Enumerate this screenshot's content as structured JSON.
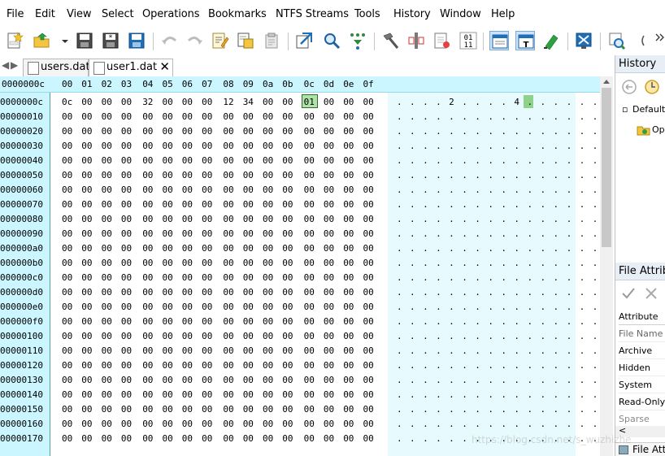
{
  "menu": {
    "items": [
      "File",
      "Edit",
      "View",
      "Select",
      "Operations",
      "Bookmarks",
      "NTFS Streams",
      "Tools",
      "History",
      "Window",
      "Help"
    ]
  },
  "toolbar": {
    "icons": [
      "new-file-icon",
      "open-file-icon",
      "dropdown-icon",
      "save-icon",
      "save-as-icon",
      "save-all-icon",
      "undo-icon",
      "redo-icon",
      "edit-icon",
      "copy-icon",
      "paste-icon",
      "goto-icon",
      "find-icon",
      "find-next-icon",
      "hammer-icon",
      "mark-icon",
      "compare-icon",
      "binary-icon",
      "view-hex-icon",
      "view-text-icon",
      "highlight-icon",
      "fullscreen-icon",
      "search-doc-icon",
      "overflow-icon"
    ]
  },
  "tabs": [
    {
      "label": "users.dat",
      "active": false
    },
    {
      "label": "user1.dat",
      "active": true,
      "close": "✕"
    }
  ],
  "hex": {
    "header_offset": "0000000c",
    "columns": [
      "00",
      "01",
      "02",
      "03",
      "04",
      "05",
      "06",
      "07",
      "08",
      "09",
      "0a",
      "0b",
      "0c",
      "0d",
      "0e",
      "0f"
    ],
    "rows": [
      {
        "offset": "0000000c",
        "bytes": [
          "0c",
          "00",
          "00",
          "00",
          "32",
          "00",
          "00",
          "00",
          "12",
          "34",
          "00",
          "00",
          "01",
          "00",
          "00",
          "00"
        ],
        "text": ". . . . 2 . . . . 4 . . . . . ."
      },
      {
        "offset": "00000010",
        "bytes": [
          "00",
          "00",
          "00",
          "00",
          "00",
          "00",
          "00",
          "00",
          "00",
          "00",
          "00",
          "00",
          "00",
          "00",
          "00",
          "00"
        ],
        "text": ". . . . . . . . . . . . . . . ."
      },
      {
        "offset": "00000020",
        "bytes": [
          "00",
          "00",
          "00",
          "00",
          "00",
          "00",
          "00",
          "00",
          "00",
          "00",
          "00",
          "00",
          "00",
          "00",
          "00",
          "00"
        ],
        "text": ". . . . . . . . . . . . . . . ."
      },
      {
        "offset": "00000030",
        "bytes": [
          "00",
          "00",
          "00",
          "00",
          "00",
          "00",
          "00",
          "00",
          "00",
          "00",
          "00",
          "00",
          "00",
          "00",
          "00",
          "00"
        ],
        "text": ". . . . . . . . . . . . . . . ."
      },
      {
        "offset": "00000040",
        "bytes": [
          "00",
          "00",
          "00",
          "00",
          "00",
          "00",
          "00",
          "00",
          "00",
          "00",
          "00",
          "00",
          "00",
          "00",
          "00",
          "00"
        ],
        "text": ". . . . . . . . . . . . . . . ."
      },
      {
        "offset": "00000050",
        "bytes": [
          "00",
          "00",
          "00",
          "00",
          "00",
          "00",
          "00",
          "00",
          "00",
          "00",
          "00",
          "00",
          "00",
          "00",
          "00",
          "00"
        ],
        "text": ". . . . . . . . . . . . . . . ."
      },
      {
        "offset": "00000060",
        "bytes": [
          "00",
          "00",
          "00",
          "00",
          "00",
          "00",
          "00",
          "00",
          "00",
          "00",
          "00",
          "00",
          "00",
          "00",
          "00",
          "00"
        ],
        "text": ". . . . . . . . . . . . . . . ."
      },
      {
        "offset": "00000070",
        "bytes": [
          "00",
          "00",
          "00",
          "00",
          "00",
          "00",
          "00",
          "00",
          "00",
          "00",
          "00",
          "00",
          "00",
          "00",
          "00",
          "00"
        ],
        "text": ". . . . . . . . . . . . . . . ."
      },
      {
        "offset": "00000080",
        "bytes": [
          "00",
          "00",
          "00",
          "00",
          "00",
          "00",
          "00",
          "00",
          "00",
          "00",
          "00",
          "00",
          "00",
          "00",
          "00",
          "00"
        ],
        "text": ". . . . . . . . . . . . . . . ."
      },
      {
        "offset": "00000090",
        "bytes": [
          "00",
          "00",
          "00",
          "00",
          "00",
          "00",
          "00",
          "00",
          "00",
          "00",
          "00",
          "00",
          "00",
          "00",
          "00",
          "00"
        ],
        "text": ". . . . . . . . . . . . . . . ."
      },
      {
        "offset": "000000a0",
        "bytes": [
          "00",
          "00",
          "00",
          "00",
          "00",
          "00",
          "00",
          "00",
          "00",
          "00",
          "00",
          "00",
          "00",
          "00",
          "00",
          "00"
        ],
        "text": ". . . . . . . . . . . . . . . ."
      },
      {
        "offset": "000000b0",
        "bytes": [
          "00",
          "00",
          "00",
          "00",
          "00",
          "00",
          "00",
          "00",
          "00",
          "00",
          "00",
          "00",
          "00",
          "00",
          "00",
          "00"
        ],
        "text": ". . . . . . . . . . . . . . . ."
      },
      {
        "offset": "000000c0",
        "bytes": [
          "00",
          "00",
          "00",
          "00",
          "00",
          "00",
          "00",
          "00",
          "00",
          "00",
          "00",
          "00",
          "00",
          "00",
          "00",
          "00"
        ],
        "text": ". . . . . . . . . . . . . . . ."
      },
      {
        "offset": "000000d0",
        "bytes": [
          "00",
          "00",
          "00",
          "00",
          "00",
          "00",
          "00",
          "00",
          "00",
          "00",
          "00",
          "00",
          "00",
          "00",
          "00",
          "00"
        ],
        "text": ". . . . . . . . . . . . . . . ."
      },
      {
        "offset": "000000e0",
        "bytes": [
          "00",
          "00",
          "00",
          "00",
          "00",
          "00",
          "00",
          "00",
          "00",
          "00",
          "00",
          "00",
          "00",
          "00",
          "00",
          "00"
        ],
        "text": ". . . . . . . . . . . . . . . ."
      },
      {
        "offset": "000000f0",
        "bytes": [
          "00",
          "00",
          "00",
          "00",
          "00",
          "00",
          "00",
          "00",
          "00",
          "00",
          "00",
          "00",
          "00",
          "00",
          "00",
          "00"
        ],
        "text": ". . . . . . . . . . . . . . . ."
      },
      {
        "offset": "00000100",
        "bytes": [
          "00",
          "00",
          "00",
          "00",
          "00",
          "00",
          "00",
          "00",
          "00",
          "00",
          "00",
          "00",
          "00",
          "00",
          "00",
          "00"
        ],
        "text": ". . . . . . . . . . . . . . . ."
      },
      {
        "offset": "00000110",
        "bytes": [
          "00",
          "00",
          "00",
          "00",
          "00",
          "00",
          "00",
          "00",
          "00",
          "00",
          "00",
          "00",
          "00",
          "00",
          "00",
          "00"
        ],
        "text": ". . . . . . . . . . . . . . . ."
      },
      {
        "offset": "00000120",
        "bytes": [
          "00",
          "00",
          "00",
          "00",
          "00",
          "00",
          "00",
          "00",
          "00",
          "00",
          "00",
          "00",
          "00",
          "00",
          "00",
          "00"
        ],
        "text": ". . . . . . . . . . . . . . . ."
      },
      {
        "offset": "00000130",
        "bytes": [
          "00",
          "00",
          "00",
          "00",
          "00",
          "00",
          "00",
          "00",
          "00",
          "00",
          "00",
          "00",
          "00",
          "00",
          "00",
          "00"
        ],
        "text": ". . . . . . . . . . . . . . . ."
      },
      {
        "offset": "00000140",
        "bytes": [
          "00",
          "00",
          "00",
          "00",
          "00",
          "00",
          "00",
          "00",
          "00",
          "00",
          "00",
          "00",
          "00",
          "00",
          "00",
          "00"
        ],
        "text": ". . . . . . . . . . . . . . . ."
      },
      {
        "offset": "00000150",
        "bytes": [
          "00",
          "00",
          "00",
          "00",
          "00",
          "00",
          "00",
          "00",
          "00",
          "00",
          "00",
          "00",
          "00",
          "00",
          "00",
          "00"
        ],
        "text": ". . . . . . . . . . . . . . . ."
      },
      {
        "offset": "00000160",
        "bytes": [
          "00",
          "00",
          "00",
          "00",
          "00",
          "00",
          "00",
          "00",
          "00",
          "00",
          "00",
          "00",
          "00",
          "00",
          "00",
          "00"
        ],
        "text": ". . . . . . . . . . . . . . . ."
      },
      {
        "offset": "00000170",
        "bytes": [
          "00",
          "00",
          "00",
          "00",
          "00",
          "00",
          "00",
          "00",
          "00",
          "00",
          "00",
          "00",
          "00",
          "00",
          "00",
          "00"
        ],
        "text": ". . . . . . . . . . . . . . . ."
      }
    ],
    "cursor_index": 12
  },
  "history_panel": {
    "title": "History",
    "items": [
      "Default",
      "Ope"
    ]
  },
  "attributes_panel": {
    "title": "File Attrib",
    "header": "Attribute",
    "rows": [
      "File Name",
      "Archive",
      "Hidden",
      "System",
      "Read-Only",
      "Sparse"
    ],
    "footer_tab": "File Att"
  },
  "watermark": "https://blog.csdn.net/s_wuzhizhe",
  "colors": {
    "header_bg": "#ccf6ff",
    "text_col_bg": "#e7fbff",
    "cursor": "#aee3a8"
  }
}
